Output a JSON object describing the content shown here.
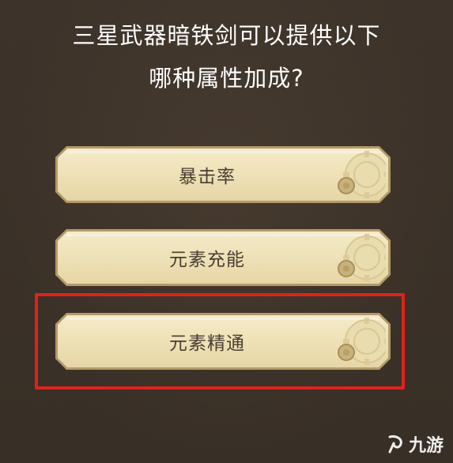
{
  "question": {
    "line1": "三星武器暗铁剑可以提供以下",
    "line2": "哪种属性加成?"
  },
  "options": [
    {
      "label": "暴击率",
      "selected": false
    },
    {
      "label": "元素充能",
      "selected": false
    },
    {
      "label": "元素精通",
      "selected": true
    }
  ],
  "colors": {
    "background": "#3b3128",
    "option_face": "#efe2b8",
    "option_text": "#4a3e33",
    "selection_highlight": "#e0221b"
  },
  "watermark": {
    "text": "九游",
    "icon": "nine-game-logo-icon"
  }
}
